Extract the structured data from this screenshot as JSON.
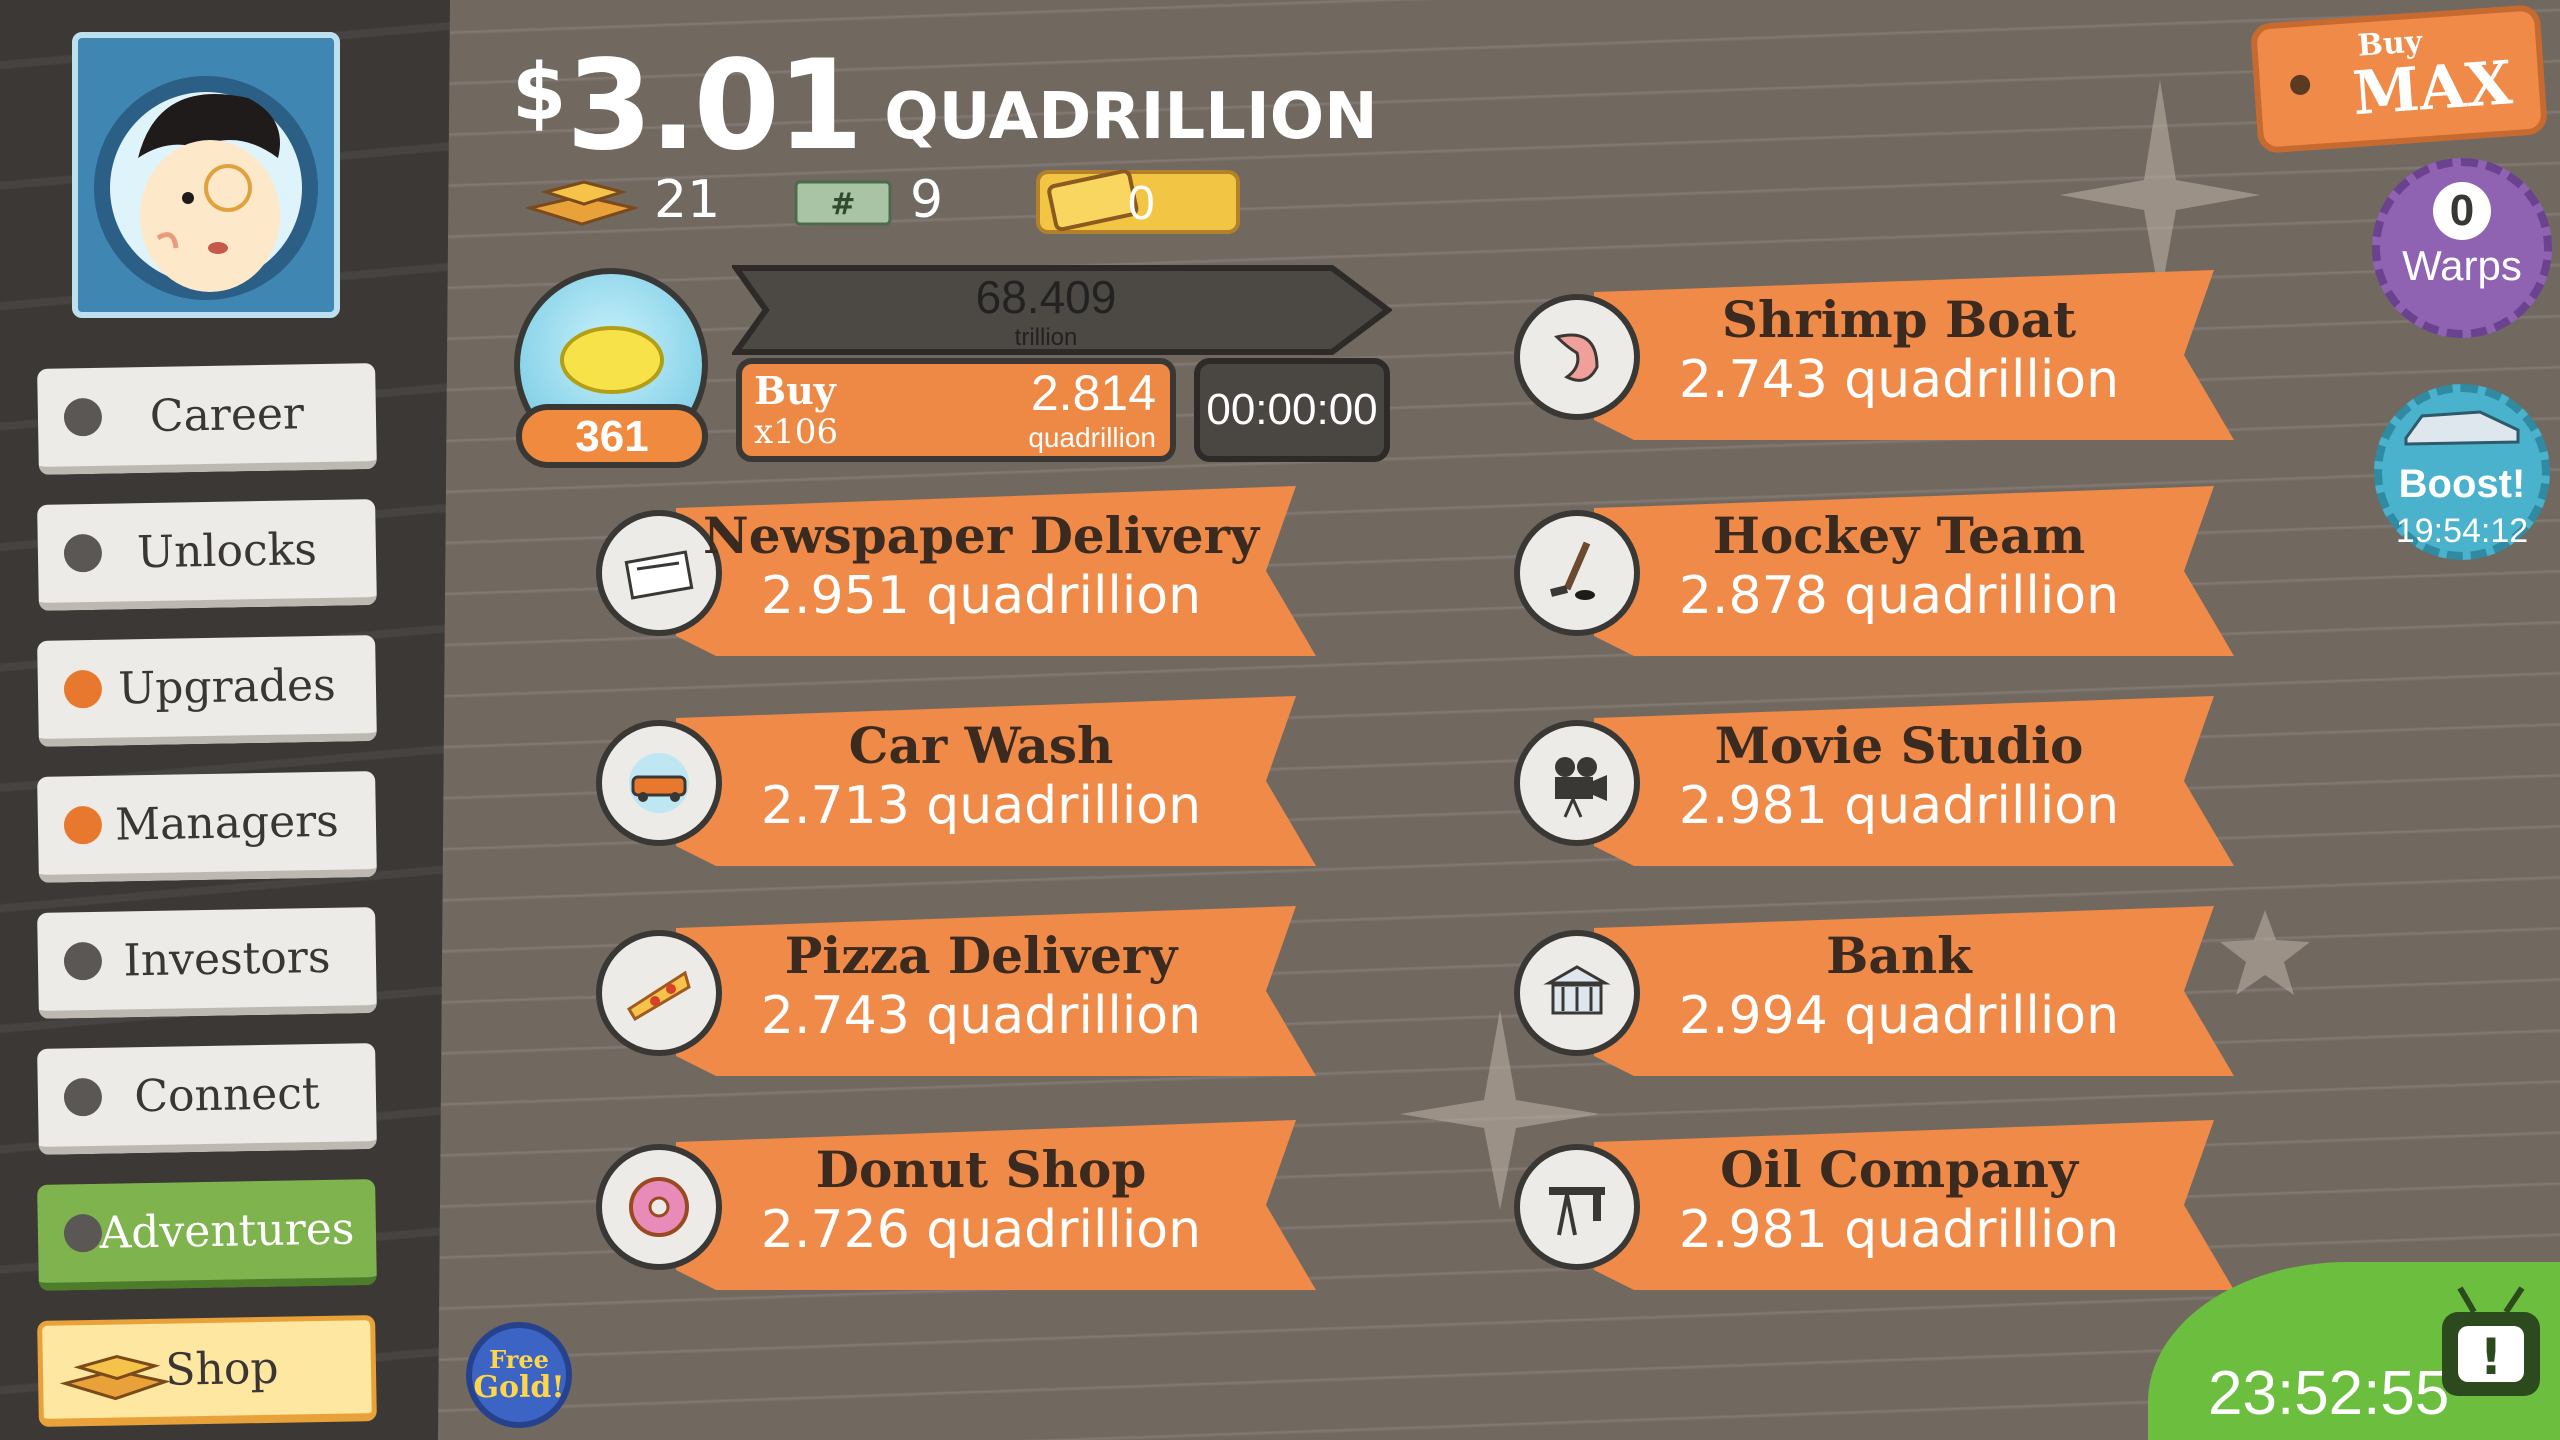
{
  "header": {
    "currency_symbol": "$",
    "money_amount": "3.01",
    "money_unit": "QUADRILLION",
    "gold_count": "21",
    "megabucks_count": "9",
    "tickets_count": "0"
  },
  "sidebar": {
    "items": [
      {
        "label": "Career"
      },
      {
        "label": "Unlocks"
      },
      {
        "label": "Upgrades"
      },
      {
        "label": "Managers"
      },
      {
        "label": "Investors"
      },
      {
        "label": "Connect"
      },
      {
        "label": "Adventures"
      },
      {
        "label": "Shop"
      }
    ]
  },
  "lemon_stand": {
    "owned": "361",
    "progress_value": "68.409",
    "progress_unit": "trillion",
    "buy_label": "Buy",
    "buy_multiplier": "x106",
    "buy_cost": "2.814",
    "buy_cost_unit": "quadrillion",
    "timer": "00:00:00"
  },
  "businesses": [
    {
      "name": "Shrimp Boat",
      "value": "2.743 quadrillion",
      "icon": "shrimp-icon"
    },
    {
      "name": "Newspaper Delivery",
      "value": "2.951 quadrillion",
      "icon": "newspaper-icon"
    },
    {
      "name": "Hockey Team",
      "value": "2.878 quadrillion",
      "icon": "hockey-icon"
    },
    {
      "name": "Car Wash",
      "value": "2.713 quadrillion",
      "icon": "car-icon"
    },
    {
      "name": "Movie Studio",
      "value": "2.981 quadrillion",
      "icon": "movie-camera-icon"
    },
    {
      "name": "Pizza Delivery",
      "value": "2.743 quadrillion",
      "icon": "pizza-icon"
    },
    {
      "name": "Bank",
      "value": "2.994 quadrillion",
      "icon": "bank-icon"
    },
    {
      "name": "Donut Shop",
      "value": "2.726 quadrillion",
      "icon": "donut-icon"
    },
    {
      "name": "Oil Company",
      "value": "2.981 quadrillion",
      "icon": "oil-derrick-icon"
    }
  ],
  "widgets": {
    "buy_label": "Buy",
    "max_label": "MAX",
    "warps_count": "0",
    "warps_label": "Warps",
    "boost_label": "Boost!",
    "boost_timer": "19:54:12",
    "free_gold_line1": "Free",
    "free_gold_line2": "Gold!",
    "tv_timer": "23:52:55"
  },
  "colors": {
    "orange": "#ef8a48",
    "background": "#716860",
    "sidebar": "#3b3835",
    "green": "#7fb34d"
  }
}
